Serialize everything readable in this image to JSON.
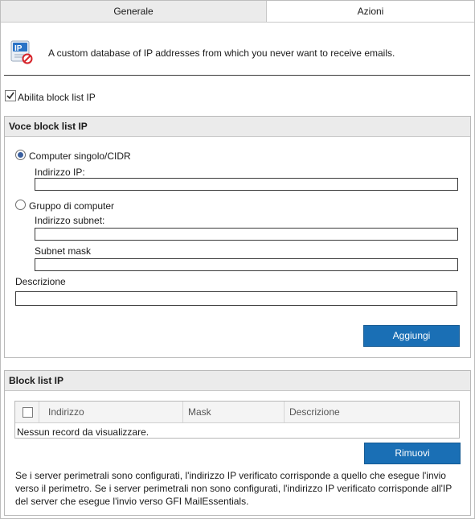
{
  "tabs": {
    "generale": "Generale",
    "azioni": "Azioni"
  },
  "info": {
    "description": "A custom database of IP addresses from which you never want to receive emails.",
    "icon": "ip-block-icon"
  },
  "enable": {
    "label": "Abilita block list IP",
    "checked": true
  },
  "entry_panel": {
    "title": "Voce block list IP",
    "radio_single": "Computer singolo/CIDR",
    "radio_single_selected": true,
    "ip_label": "Indirizzo IP:",
    "ip_value": "",
    "radio_group": "Gruppo di computer",
    "subnet_label": "Indirizzo subnet:",
    "subnet_value": "",
    "mask_label": "Subnet mask",
    "mask_value": "",
    "desc_label": "Descrizione",
    "desc_value": "",
    "add_button": "Aggiungi"
  },
  "list_panel": {
    "title": "Block list IP",
    "columns": [
      "Indirizzo",
      "Mask",
      "Descrizione"
    ],
    "empty_text": "Nessun record da visualizzare.",
    "remove_button": "Rimuovi",
    "note": "Se i server perimetrali sono configurati, l'indirizzo IP verificato corrisponde a quello che esegue l'invio verso il perimetro. Se i server perimetrali non sono configurati, l'indirizzo IP verificato corrisponde all'IP del server che esegue l'invio verso GFI MailEssentials."
  },
  "colors": {
    "accent": "#1a6fb5",
    "tab_inactive": "#ebebeb",
    "panel_header": "#ebebeb"
  }
}
